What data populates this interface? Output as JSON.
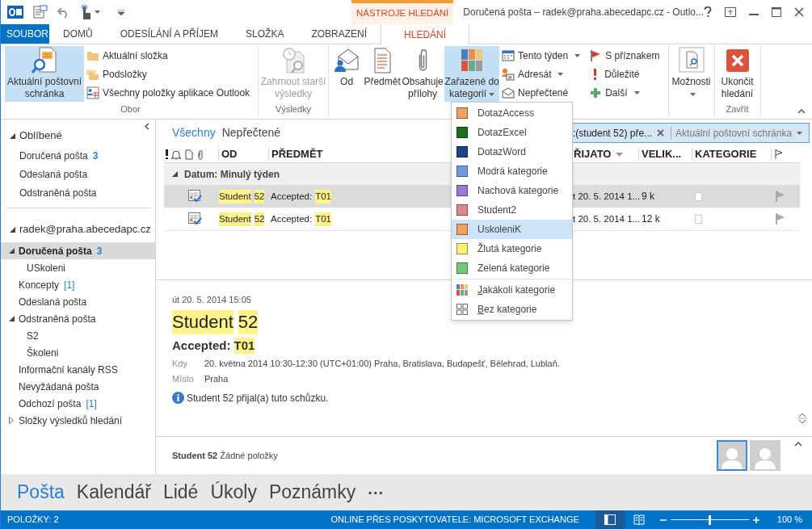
{
  "title_bar": {
    "contextual_tab": "NÁSTROJE HLEDÁNÍ",
    "title": "Doručená pošta – radek@praha.abecedapc.cz - Outlo..."
  },
  "file_tab": "SOUBOR",
  "tabs": [
    {
      "label": "DOMŮ",
      "selected": false
    },
    {
      "label": "ODESÍLÁNÍ A PŘÍJEM",
      "selected": false
    },
    {
      "label": "SLOŽKA",
      "selected": false
    },
    {
      "label": "ZOBRAZENÍ",
      "selected": false
    },
    {
      "label": "HLEDÁNÍ",
      "selected": true
    }
  ],
  "ribbon": {
    "groups": [
      {
        "label": "Obor",
        "columns": [
          {
            "kind": "large",
            "label": "Aktuální poštovní schránka",
            "selected": true,
            "disabled": false,
            "has_menu": false
          },
          {
            "kind": "stack",
            "buttons": [
              {
                "label": "Aktuální složka",
                "has_menu": false
              },
              {
                "label": "Podsložky",
                "has_menu": false
              },
              {
                "label": "Všechny položky aplikace Outlook",
                "has_menu": false
              }
            ]
          }
        ]
      },
      {
        "label": "Výsledky",
        "columns": [
          {
            "kind": "large",
            "label": "Zahrnout starší výsledky",
            "selected": false,
            "disabled": true,
            "has_menu": false
          }
        ]
      },
      {
        "columns": [
          {
            "kind": "large",
            "label": "Od",
            "selected": false,
            "disabled": false,
            "has_menu": false
          },
          {
            "kind": "large",
            "label": "Předmět",
            "selected": false,
            "disabled": false,
            "has_menu": false
          },
          {
            "kind": "large",
            "label": "Obsahuje přílohy",
            "selected": false,
            "disabled": false,
            "has_menu": false
          },
          {
            "kind": "large",
            "label": "Zařazené do kategorií",
            "selected": true,
            "disabled": false,
            "has_menu": true
          },
          {
            "kind": "stack",
            "buttons": [
              {
                "label": "Tento týden",
                "has_menu": true
              },
              {
                "label": "Adresát",
                "has_menu": true
              },
              {
                "label": "Nepřečtené",
                "has_menu": false
              }
            ]
          },
          {
            "kind": "stack",
            "buttons": [
              {
                "label": "S příznakem",
                "has_menu": false
              },
              {
                "label": "Důležité",
                "has_menu": false
              },
              {
                "label": "Další",
                "has_menu": true
              }
            ]
          }
        ]
      },
      {
        "columns": [
          {
            "kind": "large",
            "label": "Možnosti",
            "selected": false,
            "disabled": false,
            "has_menu": true
          }
        ]
      },
      {
        "label": "Zavřít",
        "columns": [
          {
            "kind": "large",
            "label": "Ukončit hledání",
            "selected": false,
            "disabled": false,
            "has_menu": false
          }
        ]
      }
    ]
  },
  "category_menu": [
    {
      "kind": "category",
      "label": "DotazAccess",
      "color": "#f0a060",
      "selected": false
    },
    {
      "kind": "category",
      "label": "DotazExcel",
      "color": "#1f6b1f",
      "selected": false
    },
    {
      "kind": "category",
      "label": "DotazWord",
      "color": "#1c448a",
      "selected": false
    },
    {
      "kind": "category",
      "label": "Modrá kategorie",
      "color": "#7399df",
      "selected": false
    },
    {
      "kind": "category",
      "label": "Nachová kategorie",
      "color": "#9a7ad4",
      "selected": false
    },
    {
      "kind": "category",
      "label": "Student2",
      "color": "#dd8a8a",
      "selected": false
    },
    {
      "kind": "category",
      "label": "UskoleniK",
      "color": "#f0a060",
      "selected": true
    },
    {
      "kind": "category",
      "label": "Žlutá kategorie",
      "color": "#f8f070",
      "selected": false
    },
    {
      "kind": "category",
      "label": "Zelená kategorie",
      "color": "#78c878",
      "selected": false
    },
    {
      "kind": "any",
      "label": "Jakákoli kategorie",
      "selected": false,
      "first_letter_underlined": true
    },
    {
      "kind": "none",
      "label": "Bez kategorie",
      "selected": false,
      "first_letter_underlined": true
    }
  ],
  "navigation": {
    "favorites": {
      "title": "Oblíbené",
      "expanded": true,
      "items": [
        {
          "label": "Doručená pošta",
          "count": "3",
          "count_bold": true,
          "selected": false
        },
        {
          "label": "Odeslaná pošta",
          "selected": false
        },
        {
          "label": "Odstraněná pošta",
          "selected": false
        }
      ]
    },
    "account": {
      "title": "radek@praha.abecedapc.cz",
      "expanded": true,
      "folders": [
        {
          "label": "Doručená pošta",
          "count": "3",
          "count_bold": true,
          "selected": true,
          "expanded": true,
          "children": [
            {
              "label": "USkoleni",
              "selected": false
            }
          ]
        },
        {
          "label": "Koncepty",
          "count": "[1]",
          "count_bold": false,
          "selected": false
        },
        {
          "label": "Odeslaná pošta",
          "selected": false
        },
        {
          "label": "Odstraněná pošta",
          "selected": false,
          "expanded": true,
          "children": [
            {
              "label": "S2",
              "selected": false
            },
            {
              "label": "Školeni",
              "selected": false
            }
          ]
        },
        {
          "label": "Informační kanály RSS",
          "selected": false
        },
        {
          "label": "Nevyžádaná pošta",
          "selected": false
        },
        {
          "label": "Odchozí pošta",
          "count": "[1]",
          "count_bold": false,
          "selected": false
        },
        {
          "label": "Složky výsledků hledání",
          "selected": false,
          "expanded": false
        }
      ]
    }
  },
  "filters": [
    {
      "label": "Všechny",
      "selected": true
    },
    {
      "label": "Nepřečtené",
      "selected": false
    }
  ],
  "search": {
    "value": ":(student 52) pře...",
    "scope": "Aktuální poštovní schránka"
  },
  "message_list": {
    "columns": [
      {
        "label": "OD",
        "sorted": false
      },
      {
        "label": "PŘEDMĚT",
        "sorted": false
      },
      {
        "label": "ŘIJATO",
        "sorted": true
      },
      {
        "label": "VELIK...",
        "sorted": false
      },
      {
        "label": "KATEGORIE",
        "sorted": false
      }
    ],
    "group": {
      "label": "Datum: Minulý týden",
      "expanded": true
    },
    "rows": [
      {
        "selected": true,
        "sender_words": [
          {
            "text": "Student",
            "highlighted": true
          },
          {
            "text": "52",
            "highlighted": true
          }
        ],
        "subject_words": [
          {
            "text": "Accepted:",
            "highlighted": false
          },
          {
            "text": "T01",
            "highlighted": true
          }
        ],
        "received": "t 20. 5. 2014 1...",
        "size": "9 k"
      },
      {
        "selected": false,
        "sender_words": [
          {
            "text": "Student",
            "highlighted": true
          },
          {
            "text": "52",
            "highlighted": true
          }
        ],
        "subject_words": [
          {
            "text": "Accepted:",
            "highlighted": false
          },
          {
            "text": "T01",
            "highlighted": true
          }
        ],
        "received": "t 20. 5. 2014 1...",
        "size": "12 k"
      }
    ]
  },
  "reading_pane": {
    "date": "út 20. 5. 2014 15:05",
    "sender_words": [
      {
        "text": "Student",
        "highlighted": true
      },
      {
        "text": "52",
        "highlighted": true
      }
    ],
    "subject_words": [
      {
        "text": "Accepted:",
        "highlighted": false
      },
      {
        "text": "T01",
        "highlighted": true
      }
    ],
    "details": [
      {
        "label": "Kdy",
        "value": "20. května 2014 10:30-12:30 (UTC+01:00) Praha, Bratislava, Budapešť, Bělehrad, Lublaň."
      },
      {
        "label": "Místo",
        "value": "Praha"
      }
    ],
    "info": "Student 52 přijal(a) tuto schůzku."
  },
  "people_pane": {
    "name": "Student 52",
    "status": "Žádné položky",
    "avatars": [
      {
        "selected": true
      },
      {
        "selected": false
      }
    ]
  },
  "bottom_nav": [
    {
      "label": "Pošta",
      "selected": true
    },
    {
      "label": "Kalendář",
      "selected": false
    },
    {
      "label": "Lidé",
      "selected": false
    },
    {
      "label": "Úkoly",
      "selected": false
    },
    {
      "label": "Poznámky",
      "selected": false
    }
  ],
  "bottom_nav_more": "···",
  "status_bar": {
    "items": "POLOŽKY: 2",
    "connection": "ONLINE PŘES POSKYTOVATELE: MICROSOFT EXCHANGE",
    "views": [
      {
        "selected": true
      },
      {
        "selected": false
      }
    ],
    "zoom": {
      "level": 0.5,
      "reading": "100 %"
    }
  }
}
